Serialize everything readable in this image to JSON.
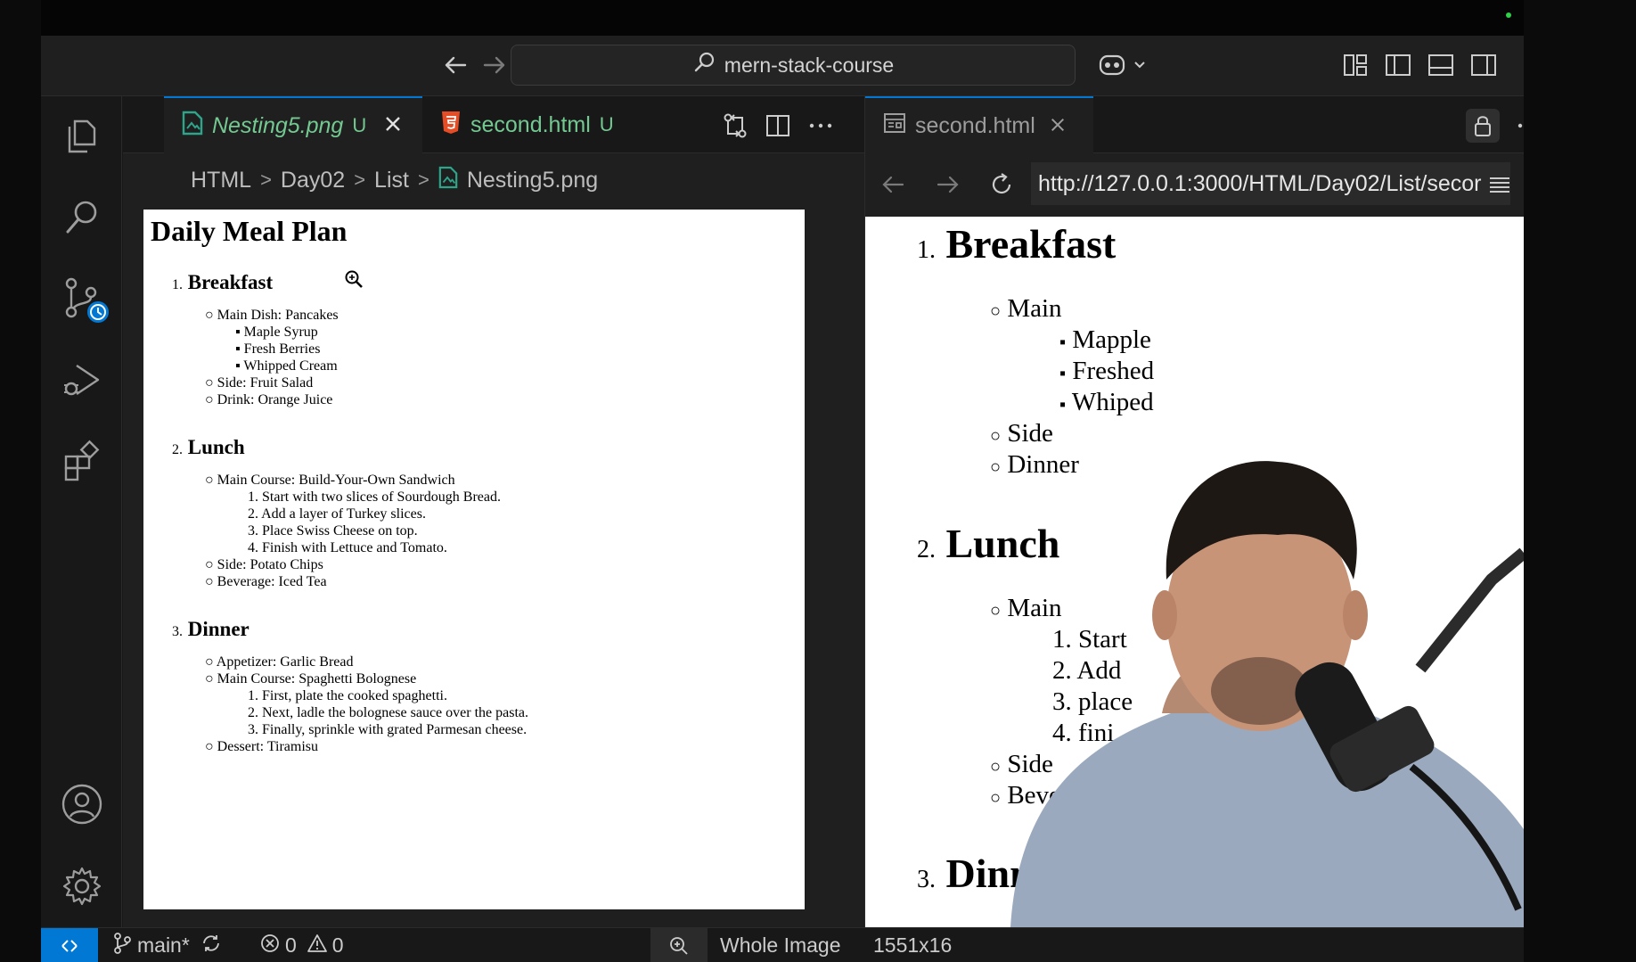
{
  "titlebar": {
    "search_text": "mern-stack-course"
  },
  "left_editor": {
    "tabs": [
      {
        "label": "Nesting5.png",
        "status": "U"
      },
      {
        "label": "second.html",
        "status": "U"
      }
    ],
    "breadcrumb": [
      "HTML",
      "Day02",
      "List",
      "Nesting5.png"
    ],
    "image": {
      "title": "Daily Meal Plan",
      "sections": [
        {
          "num": "1.",
          "title": "Breakfast",
          "lines": [
            "Main Dish: Pancakes",
            "Maple Syrup",
            "Fresh Berries",
            "Whipped Cream",
            "Side: Fruit Salad",
            "Drink: Orange Juice"
          ]
        },
        {
          "num": "2.",
          "title": "Lunch",
          "lines": [
            "Main Course: Build-Your-Own Sandwich",
            "1. Start with two slices of Sourdough Bread.",
            "2. Add a layer of Turkey slices.",
            "3. Place Swiss Cheese on top.",
            "4. Finish with Lettuce and Tomato.",
            "Side: Potato Chips",
            "Beverage: Iced Tea"
          ]
        },
        {
          "num": "3.",
          "title": "Dinner",
          "lines": [
            "Appetizer: Garlic Bread",
            "Main Course: Spaghetti Bolognese",
            "1. First, plate the cooked spaghetti.",
            "2. Next, ladle the bolognese sauce over the pasta.",
            "3. Finally, sprinkle with grated Parmesan cheese.",
            "Dessert: Tiramisu"
          ]
        }
      ]
    }
  },
  "right_editor": {
    "tab_label": "second.html",
    "url": "http://127.0.0.1:3000/HTML/Day02/List/secor",
    "preview": {
      "sections": [
        {
          "num": "1.",
          "title": "Breakfast"
        },
        {
          "num": "2.",
          "title": "Lunch"
        },
        {
          "num": "3.",
          "title": "Dinne"
        }
      ],
      "breakfast_lines": [
        "Main",
        "Mapple",
        "Freshed",
        "Whiped",
        "Side",
        "Dinner"
      ],
      "lunch_lines": [
        "Main",
        "1. Start",
        "2. Add",
        "3. place",
        "4. fini",
        "Side",
        "Beve"
      ]
    }
  },
  "statusbar": {
    "branch": "main*",
    "errors": "0",
    "warnings": "0",
    "zoom_label": "Whole Image",
    "dimensions": "1551x16"
  },
  "colors": {
    "accent": "#0078d4",
    "untracked": "#73c991",
    "html_icon": "#e44d26",
    "image_icon": "#2ea58a",
    "remote_bg": "#0078d4"
  }
}
